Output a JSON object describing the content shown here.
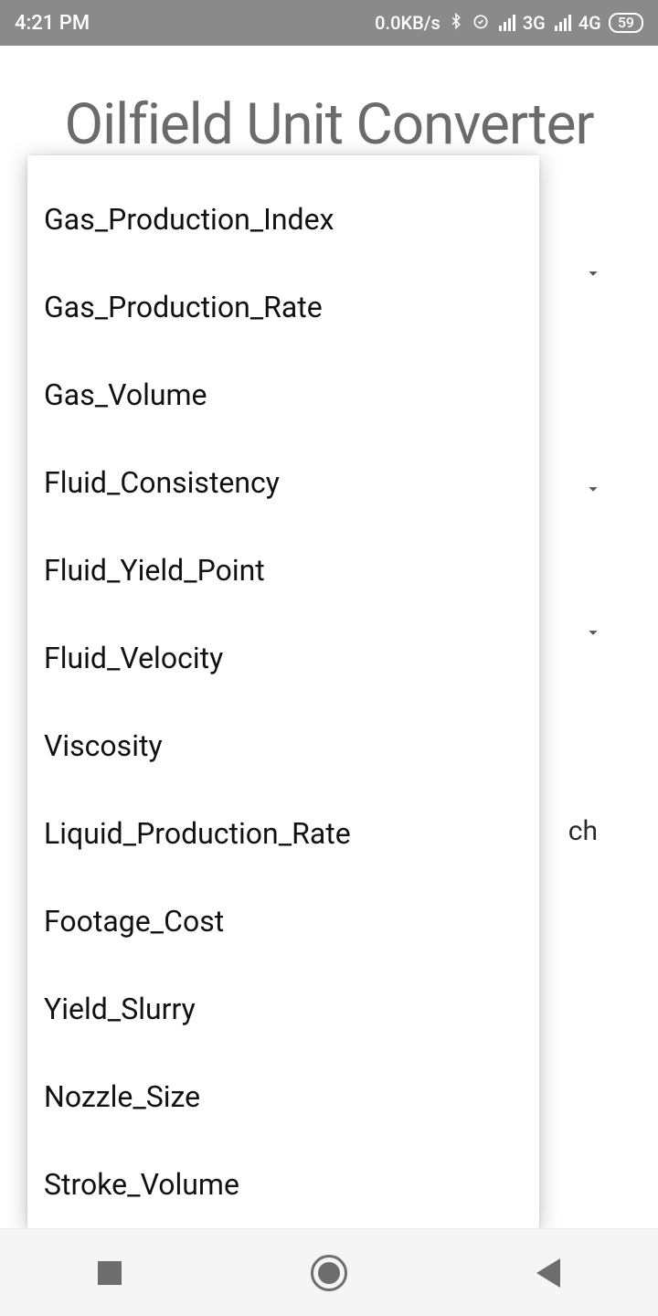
{
  "status": {
    "time": "4:21 PM",
    "speed": "0.0KB/s",
    "net1": "3G",
    "net2": "4G",
    "battery": "59"
  },
  "app": {
    "title": "Oilfield Unit Converter"
  },
  "background": {
    "peek_text": "ch"
  },
  "dropdown": {
    "items": [
      {
        "label": "Gas_Production_Index"
      },
      {
        "label": "Gas_Production_Rate"
      },
      {
        "label": "Gas_Volume"
      },
      {
        "label": "Fluid_Consistency"
      },
      {
        "label": "Fluid_Yield_Point"
      },
      {
        "label": "Fluid_Velocity"
      },
      {
        "label": "Viscosity"
      },
      {
        "label": "Liquid_Production_Rate"
      },
      {
        "label": "Footage_Cost"
      },
      {
        "label": "Yield_Slurry"
      },
      {
        "label": "Nozzle_Size"
      },
      {
        "label": "Stroke_Volume"
      }
    ]
  }
}
